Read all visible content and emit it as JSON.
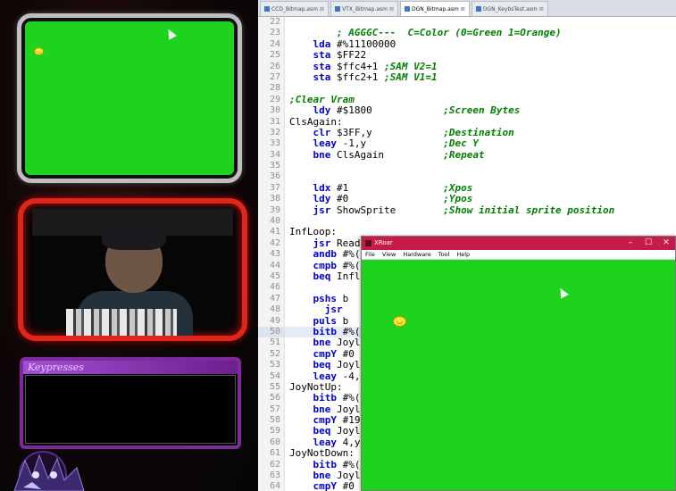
{
  "overlay": {
    "keypresses_title": "Keypresses"
  },
  "tabs": [
    {
      "label": "CCD_Bitmap.asm",
      "active": false
    },
    {
      "label": "VTX_Bitmap.asm",
      "active": false
    },
    {
      "label": "DGN_Bitmap.asm",
      "active": true
    },
    {
      "label": "DGN_KeybsTest.asm",
      "active": false
    }
  ],
  "code_lines": [
    {
      "n": "22",
      "text": ""
    },
    {
      "n": "23",
      "text": "        ; AGGGC---  C=Color (0=Green 1=Orange)"
    },
    {
      "n": "24",
      "text": "    lda #%11100000"
    },
    {
      "n": "25",
      "text": "    sta $FF22"
    },
    {
      "n": "26",
      "text": "    sta $ffc4+1 ;SAM V2=1"
    },
    {
      "n": "27",
      "text": "    sta $ffc2+1 ;SAM V1=1"
    },
    {
      "n": "28",
      "text": ""
    },
    {
      "n": "29",
      "text": ";Clear Vram"
    },
    {
      "n": "30",
      "text": "    ldy #$1800            ;Screen Bytes"
    },
    {
      "n": "31",
      "text": "ClsAgain:"
    },
    {
      "n": "32",
      "text": "    clr $3FF,y            ;Destination"
    },
    {
      "n": "33",
      "text": "    leay -1,y             ;Dec Y"
    },
    {
      "n": "34",
      "text": "    bne ClsAgain          ;Repeat"
    },
    {
      "n": "35",
      "text": ""
    },
    {
      "n": "36",
      "text": ""
    },
    {
      "n": "37",
      "text": "    ldx #1                ;Xpos"
    },
    {
      "n": "38",
      "text": "    ldy #0                ;Ypos"
    },
    {
      "n": "39",
      "text": "    jsr ShowSprite        ;Show initial sprite position"
    },
    {
      "n": "40",
      "text": ""
    },
    {
      "n": "41",
      "text": "InfLoop:"
    },
    {
      "n": "42",
      "text": "    jsr Read"
    },
    {
      "n": "43",
      "text": "    andb #%("
    },
    {
      "n": "44",
      "text": "    cmpb #%("
    },
    {
      "n": "45",
      "text": "    beq Infl"
    },
    {
      "n": "46",
      "text": ""
    },
    {
      "n": "47",
      "text": "    pshs b"
    },
    {
      "n": "48",
      "text": "      jsr"
    },
    {
      "n": "49",
      "text": "    puls b"
    },
    {
      "n": "50",
      "text": "    bitb #%("
    },
    {
      "n": "51",
      "text": "    bne Joyl"
    },
    {
      "n": "52",
      "text": "    cmpY #0"
    },
    {
      "n": "53",
      "text": "    beq Joyl"
    },
    {
      "n": "54",
      "text": "    leay -4,"
    },
    {
      "n": "55",
      "text": "JoyNotUp:"
    },
    {
      "n": "56",
      "text": "    bitb #%("
    },
    {
      "n": "57",
      "text": "    bne Joyl"
    },
    {
      "n": "58",
      "text": "    cmpY #19"
    },
    {
      "n": "59",
      "text": "    beq Joyl"
    },
    {
      "n": "60",
      "text": "    leay 4,y"
    },
    {
      "n": "61",
      "text": "JoyNotDown:"
    },
    {
      "n": "62",
      "text": "    bitb #%("
    },
    {
      "n": "63",
      "text": "    bne Joyl"
    },
    {
      "n": "64",
      "text": "    cmpY #0"
    }
  ],
  "highlight_line": "50",
  "xroar": {
    "title": "XRoar",
    "menu": [
      "File",
      "View",
      "Hardware",
      "Tool",
      "Help"
    ],
    "min": "–",
    "max": "☐",
    "close": "✕"
  },
  "colors": {
    "emulator_green": "#1ed31e",
    "xroar_titlebar": "#c71c47",
    "cam_border": "#e0261a",
    "keypress_border": "#7d2a9c"
  }
}
